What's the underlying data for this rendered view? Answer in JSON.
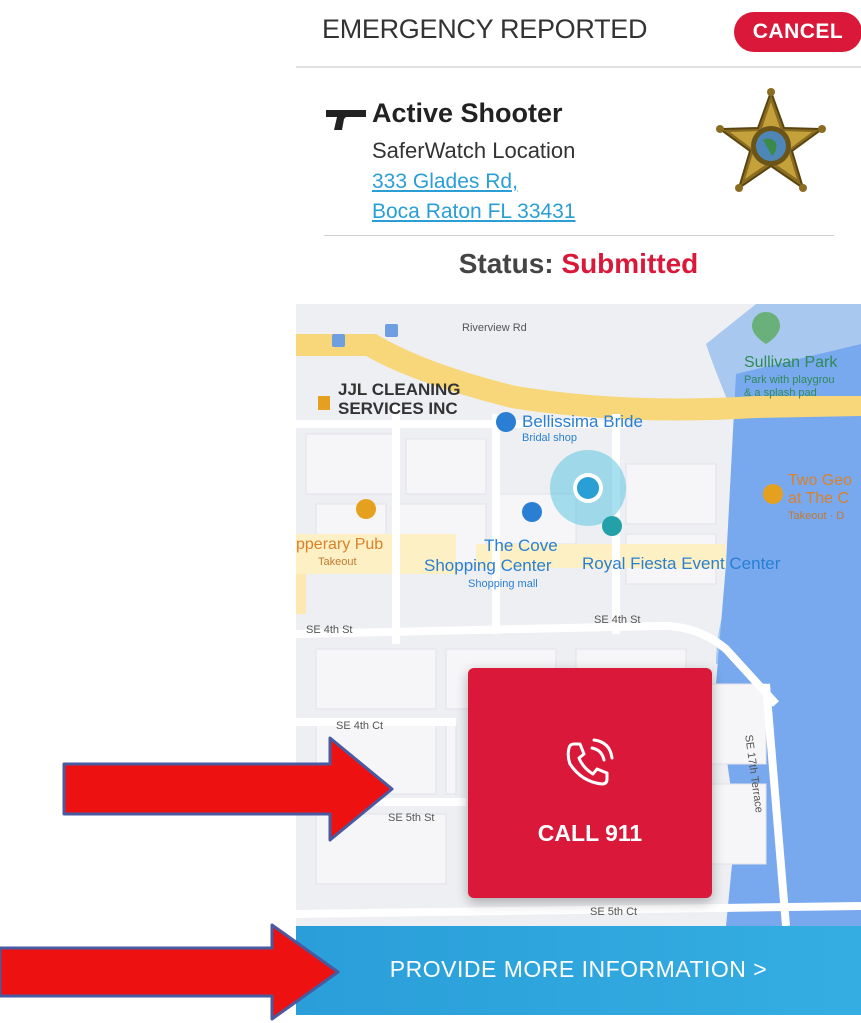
{
  "header": {
    "title": "EMERGENCY REPORTED",
    "cancel_label": "CANCEL"
  },
  "incident": {
    "type": "Active Shooter",
    "type_icon": "handgun-icon",
    "location_name": "SaferWatch Location",
    "address_line1": "333 Glades Rd,",
    "address_line2": "Boca Raton FL 33431",
    "agency_icon": "sheriff-star-badge-icon",
    "status_label": "Status:",
    "status_value": "Submitted"
  },
  "map": {
    "streets": {
      "riverview": "Riverview Rd",
      "se4th_st_1": "SE 4th St",
      "se4th_st_2": "SE 4th St",
      "se4th_ct": "SE 4th Ct",
      "se5th_st": "SE 5th St",
      "se5th_ct": "SE 5th Ct",
      "se17th": "SE 17th Terrace"
    },
    "pois": {
      "jjl_1": "JJL CLEANING",
      "jjl_2": "SERVICES INC",
      "bride": "Bellissima Bride",
      "bride_sub": "Bridal shop",
      "sullivan": "Sullivan Park",
      "sullivan_sub_1": "Park with playgrou",
      "sullivan_sub_2": "& a splash pad",
      "two_geo_1": "Two Geo",
      "two_geo_2": "at The C",
      "two_geo_sub": "Takeout · D",
      "pub": "pperary Pub",
      "pub_sub": "Takeout",
      "cove_1": "The Cove",
      "cove_2": "Shopping Center",
      "cove_sub": "Shopping mall",
      "royal": "Royal Fiesta Event Center"
    }
  },
  "actions": {
    "call_label": "CALL 911",
    "call_icon": "phone-ringing-icon",
    "more_info_label": "PROVIDE MORE INFORMATION >"
  },
  "colors": {
    "alert_red": "#d9183a",
    "link_blue": "#2a9fd6",
    "action_blue": "#2a9ed9",
    "annotation_red": "#ee1111"
  }
}
